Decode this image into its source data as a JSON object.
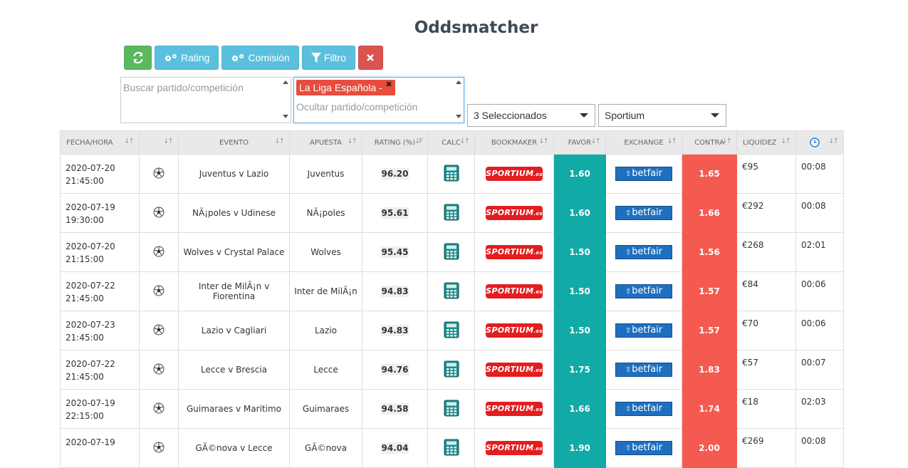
{
  "page": {
    "title": "Oddsmatcher"
  },
  "toolbar": {
    "refresh_icon": "refresh-icon",
    "rating_label": "Rating",
    "comision_label": "Comisión",
    "filtro_label": "Filtro",
    "clear_icon": "close-icon"
  },
  "search": {
    "placeholder": "Buscar partido/competición"
  },
  "hide": {
    "tag": "La Liga Española -",
    "placeholder": "Ocultar partido/competición"
  },
  "selects": {
    "sports": "3 Seleccionados",
    "bookmaker": "Sportium"
  },
  "table": {
    "headers": [
      "FECHA/HORA",
      "",
      "EVENTO",
      "APUESTA",
      "RATING (%)",
      "CALC",
      "BOOKMAKER",
      "FAVOR",
      "EXCHANGE",
      "CONTRA",
      "LIQUIDEZ",
      ""
    ],
    "bookmaker_label": "SPORTIUM",
    "bookmaker_suffix": ".es",
    "exchange_label": "betfair",
    "rows": [
      {
        "date": "2020-07-20",
        "time": "21:45:00",
        "event": "Juventus v Lazio",
        "bet": "Juventus",
        "rating": "96.20",
        "favor": "1.60",
        "contra": "1.65",
        "liquidity": "€95",
        "age": "00:08"
      },
      {
        "date": "2020-07-19",
        "time": "19:30:00",
        "event": "NÃ¡poles v Udinese",
        "bet": "NÃ¡poles",
        "rating": "95.61",
        "favor": "1.60",
        "contra": "1.66",
        "liquidity": "€292",
        "age": "00:08"
      },
      {
        "date": "2020-07-20",
        "time": "21:15:00",
        "event": "Wolves v Crystal Palace",
        "bet": "Wolves",
        "rating": "95.45",
        "favor": "1.50",
        "contra": "1.56",
        "liquidity": "€268",
        "age": "02:01"
      },
      {
        "date": "2020-07-22",
        "time": "21:45:00",
        "event": "Inter de MilÃ¡n v Fiorentina",
        "bet": "Inter de MilÃ¡n",
        "rating": "94.83",
        "favor": "1.50",
        "contra": "1.57",
        "liquidity": "€84",
        "age": "00:06"
      },
      {
        "date": "2020-07-23",
        "time": "21:45:00",
        "event": "Lazio v Cagliari",
        "bet": "Lazio",
        "rating": "94.83",
        "favor": "1.50",
        "contra": "1.57",
        "liquidity": "€70",
        "age": "00:06"
      },
      {
        "date": "2020-07-22",
        "time": "21:45:00",
        "event": "Lecce v Brescia",
        "bet": "Lecce",
        "rating": "94.76",
        "favor": "1.75",
        "contra": "1.83",
        "liquidity": "€57",
        "age": "00:07"
      },
      {
        "date": "2020-07-19",
        "time": "22:15:00",
        "event": "Guimaraes v Maritimo",
        "bet": "Guimaraes",
        "rating": "94.58",
        "favor": "1.66",
        "contra": "1.74",
        "liquidity": "€18",
        "age": "02:03"
      },
      {
        "date": "2020-07-19",
        "time": "",
        "event": "GÃ©nova v Lecce",
        "bet": "GÃ©nova",
        "rating": "94.04",
        "favor": "1.90",
        "contra": "2.00",
        "liquidity": "€269",
        "age": "00:08"
      }
    ]
  },
  "colors": {
    "favor": "#11aaa6",
    "contra": "#f45a4f",
    "green_btn": "#5cb85c",
    "blue_btn": "#5bc0de",
    "red_btn": "#d9534f"
  }
}
